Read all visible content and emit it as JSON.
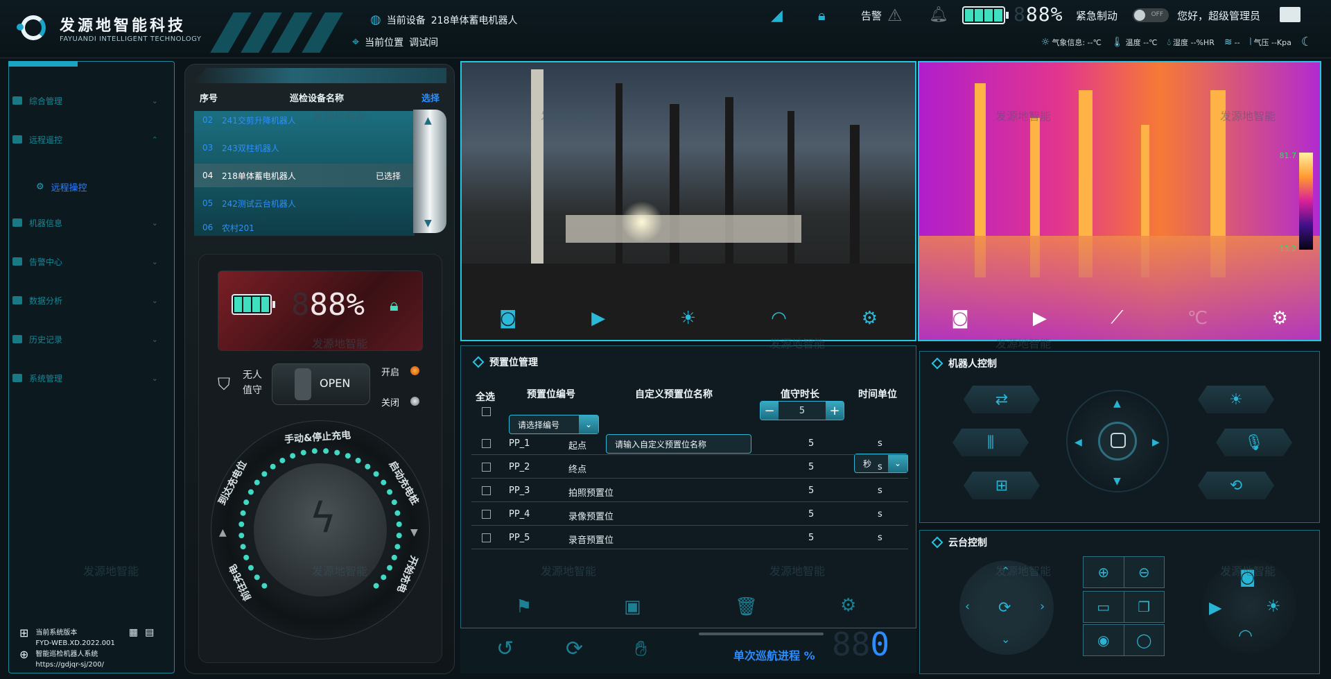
{
  "header": {
    "logo_cn": "发源地智能科技",
    "logo_en": "FAYUANDI INTELLIGENT TECHNOLOGY",
    "current_device_label": "当前设备",
    "current_device_value": "218单体蓄电机器人",
    "current_location_label": "当前位置",
    "current_location_value": "调试间",
    "alarm_label": "告警",
    "battery_digits_dim": "8",
    "battery_percent": "88%",
    "emergency_stop_label": "紧急制动",
    "toggle_state": "OFF",
    "greeting": "您好，超级管理员"
  },
  "weather": {
    "weather_label": "气象信息: --℃",
    "temperature": "温度 --℃",
    "humidity": "湿度 --%HR",
    "wind": "--",
    "pressure": "气压 --Kpa"
  },
  "sidebar": {
    "items": [
      {
        "label": "综合管理"
      },
      {
        "label": "远程遥控"
      },
      {
        "label": "机器信息"
      },
      {
        "label": "告警中心"
      },
      {
        "label": "数据分析"
      },
      {
        "label": "历史记录"
      },
      {
        "label": "系统管理"
      }
    ],
    "sub_item": "远程操控",
    "version_title": "当前系统版本",
    "version_value": "FYD-WEB.XD.2022.001",
    "system_name": "智能巡检机器人系统",
    "url": "https://gdjqr-sj/200/"
  },
  "device_list": {
    "col_index": "序号",
    "col_name": "巡检设备名称",
    "col_select": "选择",
    "rows": [
      {
        "index": "02",
        "name": "241交剪升降机器人",
        "status": ""
      },
      {
        "index": "03",
        "name": "243双柱机器人",
        "status": ""
      },
      {
        "index": "04",
        "name": "218单体蓄电机器人",
        "status": "已选择"
      },
      {
        "index": "05",
        "name": "242测试云台机器人",
        "status": ""
      },
      {
        "index": "06",
        "name": "农村201",
        "status": ""
      }
    ]
  },
  "charge_panel": {
    "battery_percent": "88%",
    "battery_digit_dim": "8",
    "unattended_line1": "无人",
    "unattended_line2": "值守",
    "switch_label": "OPEN",
    "on_label": "开启",
    "off_label": "关闭",
    "dial_top": "手动&停止充电",
    "dial_left": "到达充电位",
    "dial_right": "启动充电桩",
    "dial_bottom_left": "前往充电",
    "dial_bottom_right": "开始充电"
  },
  "thermal": {
    "max_temp": "81.7",
    "min_temp": "13.2"
  },
  "preset": {
    "title": "预置位管理",
    "select_all": "全选",
    "col_number": "预置位编号",
    "col_name": "自定义预置位名称",
    "col_duration": "值守时长",
    "col_unit": "时间单位",
    "number_placeholder": "请选择编号",
    "name_placeholder": "请输入自定义预置位名称",
    "duration_value": "5",
    "unit_value": "秒",
    "rows": [
      {
        "code": "PP_1",
        "name": "起点",
        "duration": "5",
        "unit": "s"
      },
      {
        "code": "PP_2",
        "name": "终点",
        "duration": "5",
        "unit": "s"
      },
      {
        "code": "PP_3",
        "name": "拍照预置位",
        "duration": "5",
        "unit": "s"
      },
      {
        "code": "PP_4",
        "name": "录像预置位",
        "duration": "5",
        "unit": "s"
      },
      {
        "code": "PP_5",
        "name": "录音预置位",
        "duration": "5",
        "unit": "s"
      }
    ],
    "progress_label": "单次巡航进程 %",
    "progress_digits_dim": "88",
    "progress_value": "0"
  },
  "robot_control": {
    "title": "机器人控制"
  },
  "ptz_control": {
    "title": "云台控制"
  },
  "watermark": "发源地智能",
  "colors": {
    "accent": "#25c6e3",
    "selected_blue": "#2c8fff",
    "bg": "#0b1419"
  }
}
